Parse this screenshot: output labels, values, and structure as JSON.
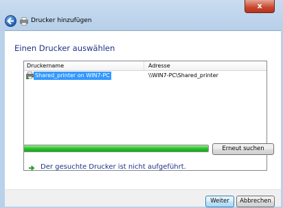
{
  "window": {
    "close_label": "x",
    "title": "Drucker hinzufügen"
  },
  "main": {
    "heading": "Einen Drucker auswählen",
    "list": {
      "columns": [
        "Druckername",
        "Adresse"
      ],
      "rows": [
        {
          "name": "Shared_printer on WIN7-PC",
          "address": "\\\\WIN7-PC\\Shared_printer",
          "selected": true
        }
      ]
    },
    "progress": 1.0,
    "search_again_label": "Erneut suchen",
    "not_listed_label": "Der gesuchte Drucker ist nicht aufgeführt."
  },
  "footer": {
    "next_label": "Weiter",
    "cancel_label": "Abbrechen"
  },
  "colors": {
    "accent": "#1e3287",
    "selection": "#3399ff",
    "progress": "#2fc22f",
    "arrow": "#2ea02e"
  }
}
